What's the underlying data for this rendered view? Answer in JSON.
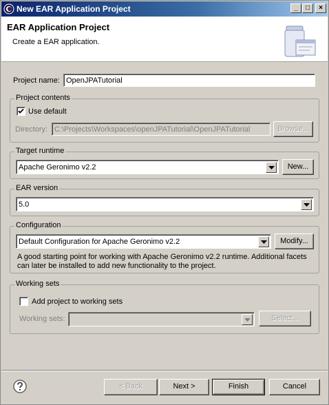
{
  "window": {
    "title": "New EAR Application Project",
    "controls": {
      "minimize": "_",
      "maximize": "□",
      "close": "×"
    }
  },
  "banner": {
    "title": "EAR Application Project",
    "subtitle": "Create a EAR application."
  },
  "project_name": {
    "label": "Project name:",
    "value": "OpenJPATutorial"
  },
  "project_contents": {
    "title": "Project contents",
    "use_default_label": "Use default",
    "use_default_checked": true,
    "directory_label": "Directory:",
    "directory_value": "C:\\Projects\\Workspaces\\openJPATutorial\\OpenJPATutorial",
    "browse_label": "Browse..."
  },
  "target_runtime": {
    "title": "Target runtime",
    "value": "Apache Geronimo v2.2",
    "new_label": "New..."
  },
  "ear_version": {
    "title": "EAR version",
    "value": "5.0"
  },
  "configuration": {
    "title": "Configuration",
    "value": "Default Configuration for Apache Geronimo v2.2",
    "modify_label": "Modify...",
    "description": "A good starting point for working with Apache Geronimo v2.2 runtime. Additional facets can later be installed to add new functionality to the project."
  },
  "working_sets": {
    "title": "Working sets",
    "add_label": "Add project to working sets",
    "add_checked": false,
    "sets_label": "Working sets:",
    "sets_value": "",
    "select_label": "Select..."
  },
  "footer": {
    "help_icon": "help-icon",
    "back_label": "< Back",
    "next_label": "Next >",
    "finish_label": "Finish",
    "cancel_label": "Cancel"
  },
  "colors": {
    "titlebar": "#0a246a",
    "dialog_bg": "#d4d0c8",
    "banner_bg": "#ffffff"
  }
}
